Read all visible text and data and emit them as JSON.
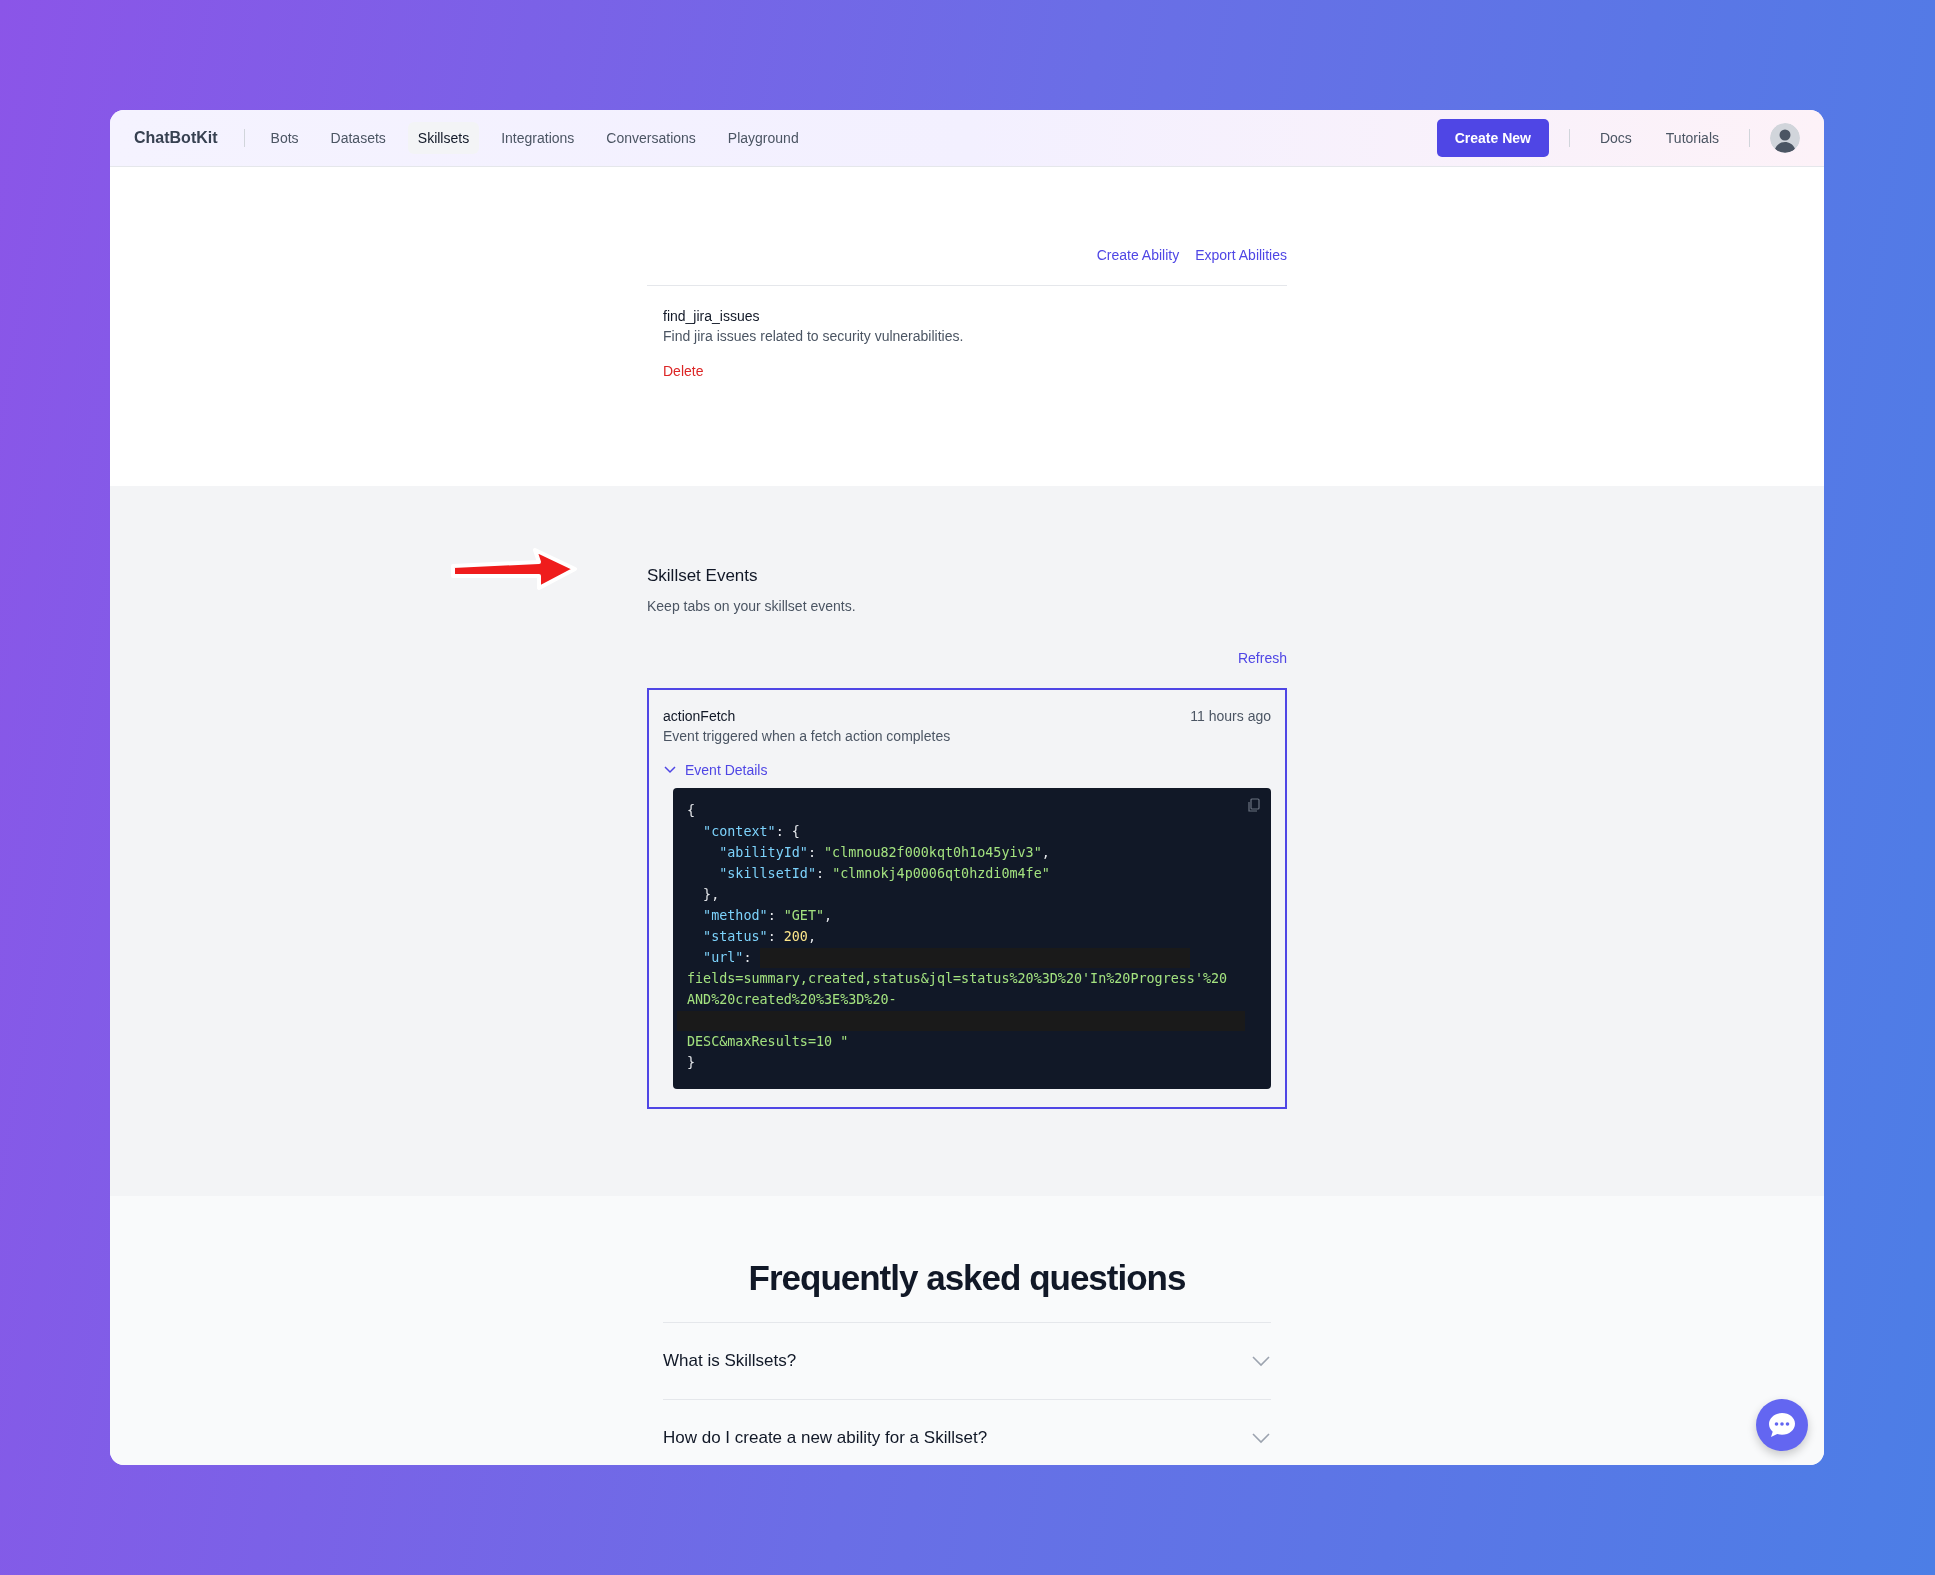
{
  "nav": {
    "brand": "ChatBotKit",
    "items": [
      {
        "label": "Bots",
        "selected": false
      },
      {
        "label": "Datasets",
        "selected": false
      },
      {
        "label": "Skillsets",
        "selected": true
      },
      {
        "label": "Integrations",
        "selected": false
      },
      {
        "label": "Conversations",
        "selected": false
      },
      {
        "label": "Playground",
        "selected": false
      }
    ],
    "create_button": "Create New",
    "links": [
      "Docs",
      "Tutorials"
    ]
  },
  "abilities": {
    "actions": [
      "Create Ability",
      "Export Abilities"
    ],
    "items": [
      {
        "name": "find_jira_issues",
        "description": "Find jira issues related to security vulnerabilities.",
        "delete": "Delete"
      }
    ]
  },
  "events": {
    "title": "Skillset Events",
    "subtitle": "Keep tabs on your skillset events.",
    "refresh": "Refresh",
    "items": [
      {
        "name": "actionFetch",
        "time": "11 hours ago",
        "description": "Event triggered when a fetch action completes",
        "details_label": "Event Details",
        "expanded": true,
        "code": [
          [
            {
              "kind": "punct",
              "text": "{"
            }
          ],
          [
            {
              "kind": "key",
              "text": "  \"context\""
            },
            {
              "kind": "punct",
              "text": ": {"
            }
          ],
          [
            {
              "kind": "key",
              "text": "    \"abilityId\""
            },
            {
              "kind": "punct",
              "text": ": "
            },
            {
              "kind": "string",
              "text": "\"clmnou82f000kqt0h1o45yiv3\""
            },
            {
              "kind": "punct",
              "text": ","
            }
          ],
          [
            {
              "kind": "key",
              "text": "    \"skillsetId\""
            },
            {
              "kind": "punct",
              "text": ": "
            },
            {
              "kind": "string",
              "text": "\"clmnokj4p0006qt0hzdi0m4fe\""
            }
          ],
          [
            {
              "kind": "punct",
              "text": "  },"
            }
          ],
          [
            {
              "kind": "key",
              "text": "  \"method\""
            },
            {
              "kind": "punct",
              "text": ": "
            },
            {
              "kind": "string",
              "text": "\"GET\""
            },
            {
              "kind": "punct",
              "text": ","
            }
          ],
          [
            {
              "kind": "key",
              "text": "  \"status\""
            },
            {
              "kind": "punct",
              "text": ": "
            },
            {
              "kind": "number",
              "text": "200"
            },
            {
              "kind": "punct",
              "text": ","
            }
          ],
          [
            {
              "kind": "key",
              "text": "  \"url\""
            },
            {
              "kind": "punct",
              "text": ": "
            },
            {
              "kind": "redacted"
            }
          ],
          [
            {
              "kind": "string",
              "text": "fields=summary,created,status&jql=status%20%3D%20'In%20Progress'%20"
            }
          ],
          [
            {
              "kind": "string",
              "text": "AND%20created%20%3E%3D%20-"
            }
          ],
          [
            {
              "kind": "redacted_line"
            }
          ],
          [
            {
              "kind": "string",
              "text": "DESC&maxResults=10 \""
            }
          ],
          [
            {
              "kind": "punct",
              "text": "}"
            }
          ]
        ]
      }
    ]
  },
  "faq": {
    "title": "Frequently asked questions",
    "items": [
      {
        "question": "What is Skillsets?",
        "expanded": false
      },
      {
        "question": "How do I create a new ability for a Skillset?",
        "expanded": false
      }
    ]
  }
}
